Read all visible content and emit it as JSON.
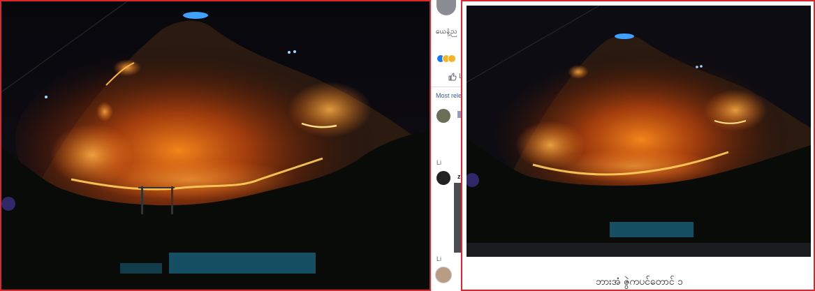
{
  "middle": {
    "page_name_fragment": "ယေနံ့ည",
    "like_fragment": "Li",
    "comments_filter_fragment": "Most relev",
    "comment_link_fragment": "Li",
    "comment_second_name_fragment": "z",
    "reply_fragment": "Li"
  },
  "right": {
    "caption": "ဘားအံ ဇွဲကပင်တောင် ၁"
  },
  "colors": {
    "border": "#e0262d",
    "link": "#385898"
  },
  "icons": [
    "like-reaction-icon",
    "haha-reaction-icon",
    "wow-reaction-icon",
    "like-thumb-icon"
  ]
}
